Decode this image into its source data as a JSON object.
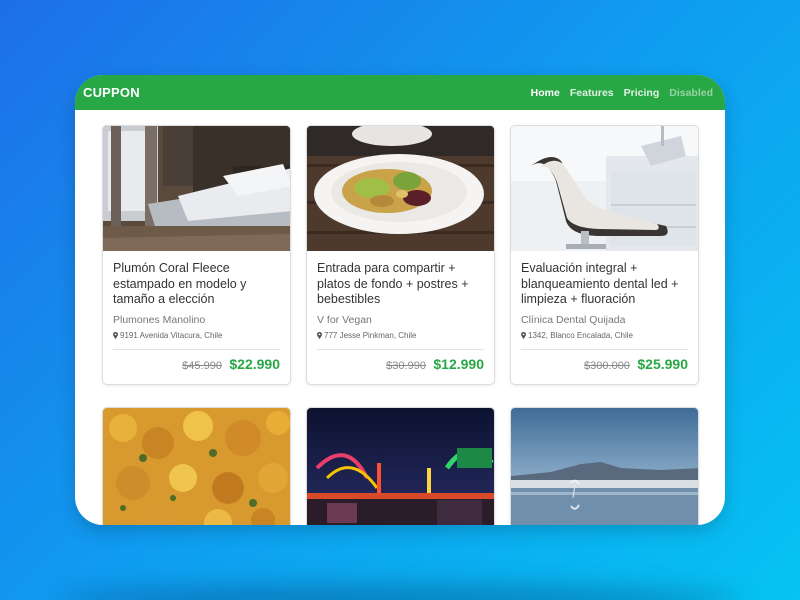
{
  "navbar": {
    "brand": "CUPPON",
    "links": [
      {
        "label": "Home",
        "state": "active"
      },
      {
        "label": "Features",
        "state": "normal"
      },
      {
        "label": "Pricing",
        "state": "normal"
      },
      {
        "label": "Disabled",
        "state": "disabled"
      }
    ]
  },
  "colors": {
    "brand_green": "#28a745",
    "background_gradient": [
      "#1e6fe8",
      "#06c3f2"
    ]
  },
  "deals": [
    {
      "title": "Plumón Coral Fleece estampado en modelo y tamaño a elección",
      "merchant": "Plumones Manolino",
      "address": "9191 Avenida Vitacura, Chile",
      "old_price": "$45.990",
      "new_price": "$22.990",
      "image": "bedroom-photo"
    },
    {
      "title": "Entrada para compartir + platos de fondo + postres + bebestibles",
      "merchant": "V for Vegan",
      "address": "777 Jesse Pinkman, Chile",
      "old_price": "$30.990",
      "new_price": "$12.990",
      "image": "salad-bowl-photo"
    },
    {
      "title": "Evaluación integral + blanqueamiento dental led + limpieza + fluoración",
      "merchant": "Clínica Dental Quijada",
      "address": "1342, Blanco Encalada, Chile",
      "old_price": "$300.000",
      "new_price": "$25.990",
      "image": "dental-chair-photo"
    },
    {
      "image": "curry-food-photo"
    },
    {
      "image": "carnival-night-photo"
    },
    {
      "image": "salt-lake-flamingo-photo"
    }
  ]
}
